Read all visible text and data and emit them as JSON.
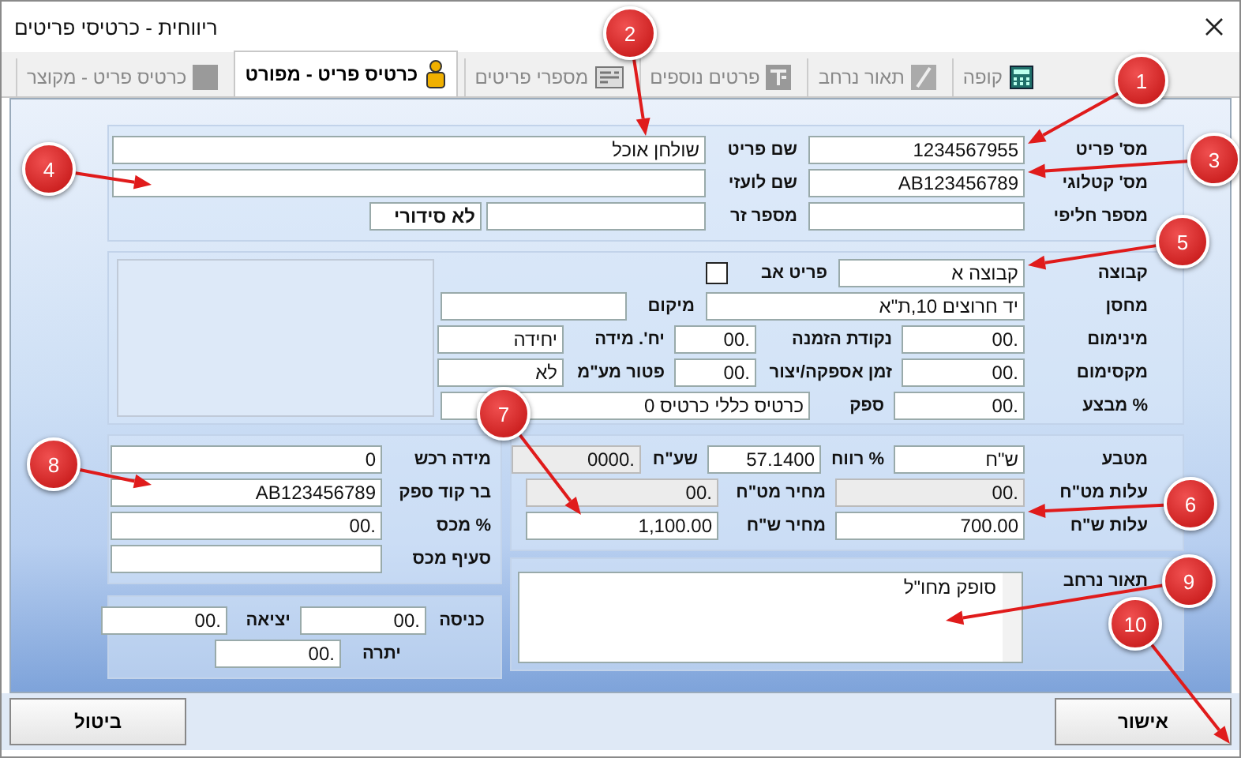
{
  "window": {
    "title": "ריווחית - כרטיסי פריטים"
  },
  "tabs": [
    {
      "label": "קופה",
      "selected": false
    },
    {
      "label": "תאור נרחב",
      "selected": false
    },
    {
      "label": "פרטים נוספים",
      "selected": false
    },
    {
      "label": "מספרי פריטים",
      "selected": false
    },
    {
      "label": "כרטיס פריט - מפורט",
      "selected": true
    },
    {
      "label": "כרטיס פריט - מקוצר",
      "selected": false
    }
  ],
  "item_header": {
    "rows": [
      {
        "items": [
          {
            "kind": "field",
            "label": "מס' פריט",
            "value": "1234567955",
            "disabled": false
          },
          {
            "kind": "field",
            "label": "שם פריט",
            "value": "שולחן אוכל",
            "disabled": false
          }
        ]
      },
      {
        "items": [
          {
            "kind": "field",
            "label": "מס' קטלוגי",
            "value": "AB123456789",
            "disabled": false
          },
          {
            "kind": "field",
            "label": "שם לועזי",
            "disabled": false
          }
        ]
      },
      {
        "items": [
          {
            "kind": "field",
            "label": "מספר חליפי",
            "disabled": false
          },
          {
            "kind": "field",
            "label": "מספר זר",
            "disabled": false
          },
          {
            "kind": "flag",
            "text": "לא סידורי"
          }
        ]
      }
    ]
  },
  "stock": {
    "rows": [
      {
        "items": [
          {
            "kind": "field",
            "label": "קבוצה",
            "value": "קבוצה א",
            "disabled": false
          },
          {
            "kind": "checkbox",
            "label": "פריט אב",
            "checked": false
          }
        ]
      },
      {
        "items": [
          {
            "kind": "field",
            "label": "מחסן",
            "value": "יד חרוצים 10,ת\"א",
            "disabled": false
          },
          {
            "kind": "field",
            "label": "מיקום",
            "disabled": false
          }
        ]
      },
      {
        "items": [
          {
            "kind": "field",
            "label": "מינימום",
            "value": ".00",
            "disabled": false
          },
          {
            "kind": "field",
            "label": "נקודת הזמנה",
            "value": ".00",
            "disabled": false
          },
          {
            "kind": "field",
            "label": "יח'. מידה",
            "value": "יחידה",
            "disabled": false
          }
        ]
      },
      {
        "items": [
          {
            "kind": "field",
            "label": "מקסימום",
            "value": ".00",
            "disabled": false
          },
          {
            "kind": "field",
            "label": "זמן אספקה/יצור",
            "value": ".00",
            "disabled": false
          },
          {
            "kind": "field",
            "label": "פטור מע\"מ",
            "value": "לא",
            "disabled": false
          }
        ]
      },
      {
        "items": [
          {
            "kind": "field",
            "label": "% מבצע",
            "value": ".00",
            "disabled": false
          },
          {
            "kind": "field",
            "label": "ספק",
            "value": "כרטיס כללי כרטיס 0",
            "disabled": false
          }
        ]
      }
    ]
  },
  "purchase": {
    "rows": [
      {
        "items": [
          {
            "kind": "field",
            "label": "מידה רכש",
            "value": "0",
            "disabled": false
          }
        ]
      },
      {
        "items": [
          {
            "kind": "field",
            "label": "בר קוד ספק",
            "value": "AB123456789",
            "disabled": false
          }
        ]
      },
      {
        "items": [
          {
            "kind": "field",
            "label": "% מכס",
            "value": ".00",
            "disabled": false
          }
        ]
      },
      {
        "items": [
          {
            "kind": "field",
            "label": "סעיף מכס",
            "disabled": false
          }
        ]
      }
    ]
  },
  "pricing": {
    "rows": [
      {
        "items": [
          {
            "kind": "field",
            "label": "מטבע",
            "value": "ש\"ח",
            "disabled": false
          },
          {
            "kind": "field",
            "label": "% רווח",
            "value": "57.1400",
            "disabled": false
          },
          {
            "kind": "field",
            "label": "שע\"ח",
            "value": ".0000",
            "disabled": true
          }
        ]
      },
      {
        "items": [
          {
            "kind": "field",
            "label": "עלות מט\"ח",
            "value": ".00",
            "disabled": true
          },
          {
            "kind": "field",
            "label": "מחיר מט\"ח",
            "value": ".00",
            "disabled": true
          }
        ]
      },
      {
        "items": [
          {
            "kind": "field",
            "label": "עלות ש\"ח",
            "value": "700.00",
            "disabled": false
          },
          {
            "kind": "field",
            "label": "מחיר ש\"ח",
            "value": "1,100.00",
            "disabled": false
          }
        ]
      }
    ]
  },
  "description": {
    "label": "תאור נרחב",
    "value": "סופק מחו\"ל"
  },
  "balance": {
    "rows": [
      {
        "items": [
          {
            "kind": "field",
            "label": "כניסה",
            "value": ".00",
            "disabled": false
          },
          {
            "kind": "field",
            "label": "יציאה",
            "value": ".00",
            "disabled": false
          }
        ]
      },
      {
        "items": [
          {
            "kind": "field",
            "label": "יתרה",
            "value": ".00",
            "disabled": false
          }
        ]
      }
    ]
  },
  "buttons": [
    {
      "label": "אישור"
    },
    {
      "label": "ביטול"
    }
  ],
  "callouts": [
    {
      "label": "1"
    },
    {
      "label": "2"
    },
    {
      "label": "3"
    },
    {
      "label": "4"
    },
    {
      "label": "5"
    },
    {
      "label": "6"
    },
    {
      "label": "7"
    },
    {
      "label": "8"
    },
    {
      "label": "9"
    },
    {
      "label": "10"
    }
  ]
}
